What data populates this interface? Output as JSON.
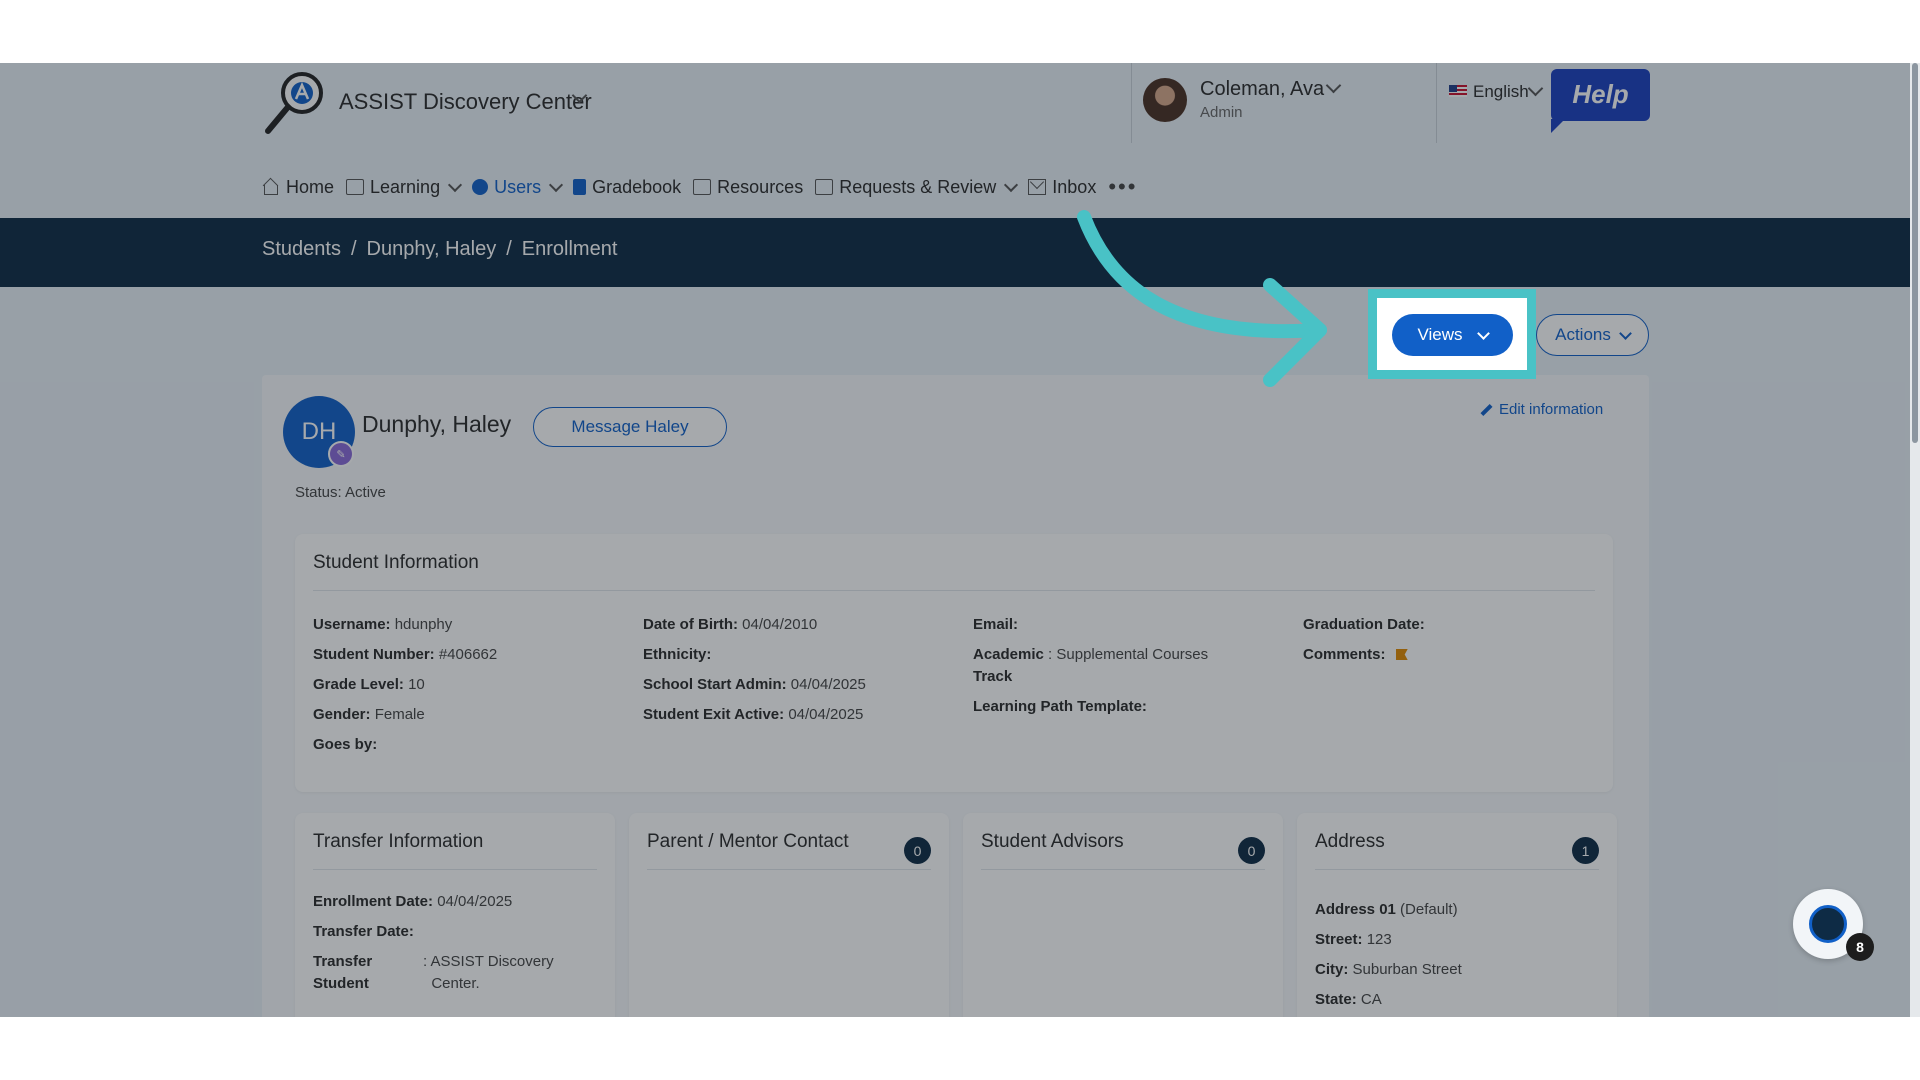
{
  "header": {
    "app_title": "ASSIST Discovery Center",
    "user_name": "Coleman, Ava",
    "user_role": "Admin",
    "language": "English",
    "help_label": "Help"
  },
  "nav": {
    "items": [
      {
        "label": "Home",
        "icon": "home-icon",
        "has_menu": false
      },
      {
        "label": "Learning",
        "icon": "learning-icon",
        "has_menu": true
      },
      {
        "label": "Users",
        "icon": "user-icon",
        "has_menu": true,
        "active": true
      },
      {
        "label": "Gradebook",
        "icon": "gradebook-icon",
        "has_menu": false
      },
      {
        "label": "Resources",
        "icon": "resources-icon",
        "has_menu": false
      },
      {
        "label": "Requests & Review",
        "icon": "requests-icon",
        "has_menu": true
      },
      {
        "label": "Inbox",
        "icon": "mail-icon",
        "has_menu": false
      }
    ],
    "more": "•••"
  },
  "breadcrumb": {
    "items": [
      "Students",
      "Dunphy, Haley",
      "Enrollment"
    ],
    "separator": "/"
  },
  "toolbar": {
    "views_label": "Views",
    "actions_label": "Actions"
  },
  "student": {
    "initials": "DH",
    "name": "Dunphy, Haley",
    "message_label": "Message Haley",
    "edit_label": "Edit information",
    "status": "Status: Active"
  },
  "student_info": {
    "title": "Student Information",
    "col1": [
      {
        "label": "Username",
        "value": "hdunphy"
      },
      {
        "label": "Student Number",
        "value": "#406662"
      },
      {
        "label": "Grade Level",
        "value": "10"
      },
      {
        "label": "Gender",
        "value": "Female"
      },
      {
        "label": "Goes by",
        "value": ""
      }
    ],
    "col2": [
      {
        "label": "Date of Birth",
        "value": "04/04/2010"
      },
      {
        "label": "Ethnicity",
        "value": ""
      },
      {
        "label": "School Start Admin",
        "value": "04/04/2025"
      },
      {
        "label": "Student Exit Active",
        "value": "04/04/2025"
      }
    ],
    "col3": [
      {
        "label": "Email",
        "value": ""
      },
      {
        "label": "Academic Track",
        "label_line1": "Academic",
        "label_line2": "Track",
        "value": "Supplemental Courses"
      },
      {
        "label": "Learning Path Template",
        "value": ""
      }
    ],
    "col4": [
      {
        "label": "Graduation Date",
        "value": ""
      },
      {
        "label": "Comments",
        "value": ""
      }
    ]
  },
  "transfer": {
    "title": "Transfer Information",
    "enrollment_date_label": "Enrollment Date",
    "enrollment_date": "04/04/2025",
    "transfer_date_label": "Transfer Date",
    "transfer_student_label_1": "Transfer",
    "transfer_student_label_2": "Student",
    "transfer_student_value_1": ": ASSIST Discovery",
    "transfer_student_value_2": "Center."
  },
  "parent": {
    "title": "Parent / Mentor Contact",
    "count": "0"
  },
  "advisors": {
    "title": "Student Advisors",
    "count": "0"
  },
  "address": {
    "title": "Address",
    "count": "1",
    "entry_label": "Address 01",
    "entry_note": "(Default)",
    "street_label": "Street",
    "street": "123",
    "city_label": "City",
    "city": "Suburban Street",
    "state_label": "State",
    "state": "CA"
  },
  "assistant": {
    "count": "8"
  },
  "colors": {
    "accent": "#1160c8",
    "navbar_dark": "#0e2b45",
    "highlight": "#49c2c6",
    "help_blue": "#1a3fbf",
    "flag_orange": "#e08a00"
  }
}
